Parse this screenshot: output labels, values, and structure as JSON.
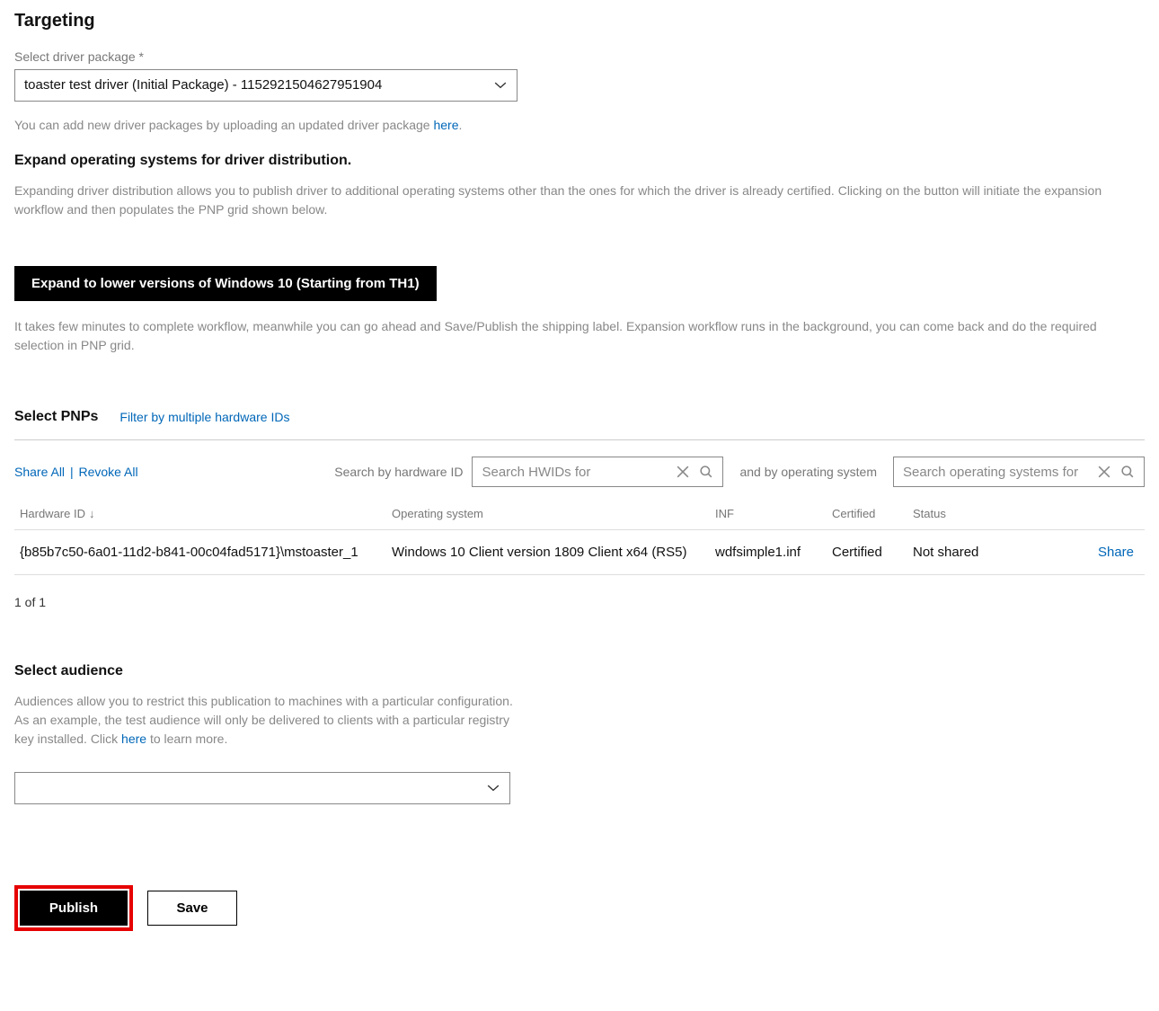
{
  "targeting": {
    "title": "Targeting",
    "package_label": "Select driver package *",
    "package_value": "toaster test driver (Initial Package) - 1152921504627951904",
    "help_prefix": "You can add new driver packages by uploading an updated driver package ",
    "help_link": "here",
    "help_suffix": "."
  },
  "expand": {
    "heading": "Expand operating systems for driver distribution.",
    "desc": "Expanding driver distribution allows you to publish driver to additional operating systems other than the ones for which the driver is already certified. Clicking on the button will initiate the expansion workflow and then populates the PNP grid shown below.",
    "button": "Expand to lower versions of Windows 10 (Starting from TH1)",
    "note": "It takes few minutes to complete workflow, meanwhile you can go ahead and Save/Publish the shipping label. Expansion workflow runs in the background, you can come back and do the required selection in PNP grid."
  },
  "pnp": {
    "title": "Select PNPs",
    "filter_link": "Filter by multiple hardware IDs",
    "share_all": "Share All",
    "revoke_all": "Revoke All",
    "search_hw_label": "Search by hardware ID",
    "search_hw_placeholder": "Search HWIDs for",
    "and_os_label": "and by operating system",
    "search_os_placeholder": "Search operating systems for",
    "columns": {
      "hwid": "Hardware ID",
      "os": "Operating system",
      "inf": "INF",
      "cert": "Certified",
      "status": "Status"
    },
    "row": {
      "hwid": "{b85b7c50-6a01-11d2-b841-00c04fad5171}\\mstoaster_1",
      "os": "Windows 10 Client version 1809 Client x64 (RS5)",
      "inf": "wdfsimple1.inf",
      "cert": "Certified",
      "status": "Not shared",
      "action": "Share"
    },
    "pagination": "1 of 1"
  },
  "audience": {
    "title": "Select audience",
    "desc_prefix": "Audiences allow you to restrict this publication to machines with a particular configuration. As an example, the test audience will only be delivered to clients with a particular registry key installed. Click ",
    "desc_link": "here",
    "desc_suffix": " to learn more.",
    "value": ""
  },
  "footer": {
    "publish": "Publish",
    "save": "Save"
  }
}
